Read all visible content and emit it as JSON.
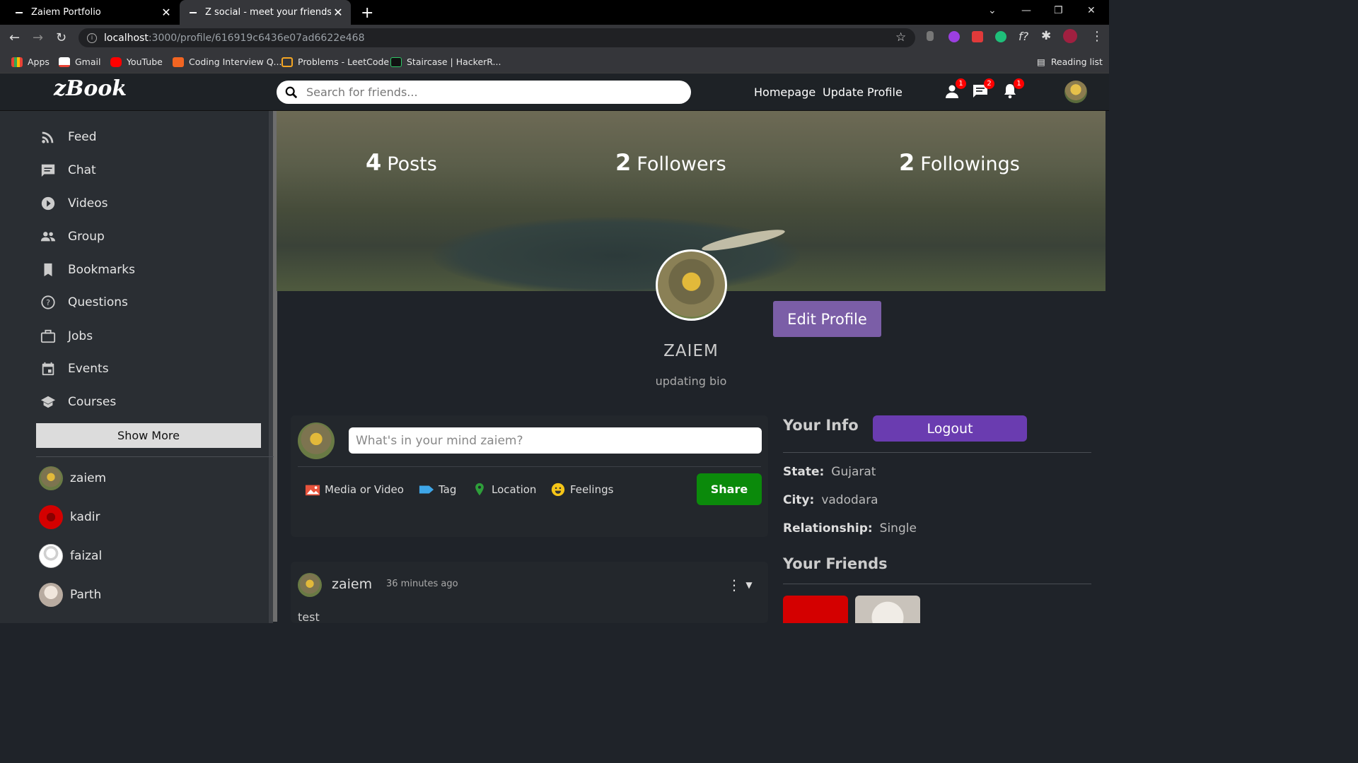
{
  "browser": {
    "tabs": [
      {
        "title": "Zaiem Portfolio"
      },
      {
        "title": "Z social - meet your friends online"
      }
    ],
    "url_host": "localhost",
    "url_path": ":3000/profile/616919c6436e07ad6622e468",
    "bookmarks": [
      "Apps",
      "Gmail",
      "YouTube",
      "Coding Interview Q...",
      "Problems - LeetCode",
      "Staircase | HackerR..."
    ],
    "reading_list": "Reading list"
  },
  "header": {
    "logo": "zBook",
    "search_placeholder": "Search for friends...",
    "nav": [
      "Homepage",
      "Update Profile"
    ],
    "badges": {
      "friends": "1",
      "messages": "2",
      "notifications": "1"
    }
  },
  "sidebar": {
    "items": [
      {
        "label": "Feed",
        "icon": "rss-icon"
      },
      {
        "label": "Chat",
        "icon": "chat-icon"
      },
      {
        "label": "Videos",
        "icon": "play-circle-icon"
      },
      {
        "label": "Group",
        "icon": "group-icon"
      },
      {
        "label": "Bookmarks",
        "icon": "bookmark-icon"
      },
      {
        "label": "Questions",
        "icon": "help-circle-icon"
      },
      {
        "label": "Jobs",
        "icon": "briefcase-icon"
      },
      {
        "label": "Events",
        "icon": "calendar-icon"
      },
      {
        "label": "Courses",
        "icon": "school-icon"
      }
    ],
    "show_more": "Show More",
    "friends": [
      "zaiem",
      "kadir",
      "faizal",
      "Parth"
    ]
  },
  "profile": {
    "posts_count": "4",
    "posts_label": "Posts",
    "followers_count": "2",
    "followers_label": "Followers",
    "followings_count": "2",
    "followings_label": "Followings",
    "edit_label": "Edit Profile",
    "name": "ZAIEM",
    "bio": "updating bio"
  },
  "composer": {
    "placeholder": "What's in your mind zaiem?",
    "options": [
      "Media or Video",
      "Tag",
      "Location",
      "Feelings"
    ],
    "share": "Share"
  },
  "post": {
    "user": "zaiem",
    "time": "36 minutes ago",
    "text": "test"
  },
  "info": {
    "title": "Your Info",
    "logout": "Logout",
    "state_label": "State:",
    "state": "Gujarat",
    "city_label": "City:",
    "city": "vadodara",
    "relationship_label": "Relationship:",
    "relationship": "Single",
    "friends_title": "Your Friends"
  },
  "colors": {
    "accent_purple": "#7b5ea7",
    "logout_purple": "#6a3cb0",
    "share_green": "#0b8a0b",
    "badge_red": "#ff0000"
  }
}
